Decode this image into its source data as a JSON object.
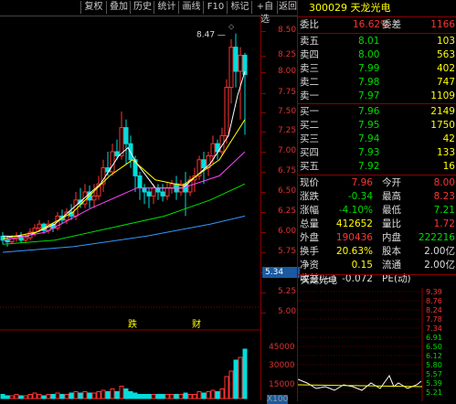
{
  "toolbar": {
    "buttons": [
      "复权",
      "叠加",
      "历史",
      "统计",
      "画线",
      "F10",
      "标记",
      "+自选",
      "返回"
    ]
  },
  "chart": {
    "max_label": "8.47",
    "annotations": [
      "跌",
      "财"
    ],
    "price_ticks": [
      "8.50",
      "8.25",
      "8.00",
      "7.75",
      "7.50",
      "7.25",
      "7.00",
      "6.75",
      "6.50",
      "6.25",
      "6.00",
      "5.75",
      "5.50",
      "5.25",
      "5.00"
    ],
    "current_price_tag": "5.34",
    "volume_ticks": [
      "45000",
      "30000",
      "15000"
    ],
    "vol_unit": "X100"
  },
  "quote": {
    "code": "300029",
    "name": "天龙光电",
    "weibi_label": "委比",
    "weibi_value": "16.62%",
    "weicha_label": "委差",
    "weicha_value": "1166",
    "asks": [
      {
        "label": "卖五",
        "price": "8.01",
        "vol": "103"
      },
      {
        "label": "卖四",
        "price": "8.00",
        "vol": "563"
      },
      {
        "label": "卖三",
        "price": "7.99",
        "vol": "402"
      },
      {
        "label": "卖二",
        "price": "7.98",
        "vol": "747"
      },
      {
        "label": "卖一",
        "price": "7.97",
        "vol": "1109"
      }
    ],
    "bids": [
      {
        "label": "买一",
        "price": "7.96",
        "vol": "2149"
      },
      {
        "label": "买二",
        "price": "7.95",
        "vol": "1750"
      },
      {
        "label": "买三",
        "price": "7.94",
        "vol": "42"
      },
      {
        "label": "买四",
        "price": "7.93",
        "vol": "133"
      },
      {
        "label": "买五",
        "price": "7.92",
        "vol": "16"
      }
    ],
    "stats": [
      {
        "l1": "现价",
        "v1": "7.96",
        "c1": "red",
        "l2": "今开",
        "v2": "8.00",
        "c2": "red"
      },
      {
        "l1": "涨跌",
        "v1": "-0.34",
        "c1": "green",
        "l2": "最高",
        "v2": "8.23",
        "c2": "red"
      },
      {
        "l1": "涨幅",
        "v1": "-4.10%",
        "c1": "green",
        "l2": "最低",
        "v2": "7.21",
        "c2": "green"
      },
      {
        "l1": "总量",
        "v1": "412652",
        "c1": "yellow",
        "l2": "量比",
        "v2": "1.72",
        "c2": "red"
      },
      {
        "l1": "外盘",
        "v1": "190436",
        "c1": "red",
        "l2": "内盘",
        "v2": "222216",
        "c2": "green"
      },
      {
        "l1": "换手",
        "v1": "20.63%",
        "c1": "yellow",
        "l2": "股本",
        "v2": "2.00亿",
        "c2": "white"
      },
      {
        "l1": "净资",
        "v1": "0.15",
        "c1": "yellow",
        "l2": "流通",
        "v2": "2.00亿",
        "c2": "white"
      },
      {
        "l1": "收益(三)",
        "v1": "-0.072",
        "c1": "white",
        "l2": "PE(动)",
        "v2": "",
        "c2": "white"
      }
    ]
  },
  "mini": {
    "title": "天龙光电",
    "ticks": [
      "9.39",
      "8.76",
      "8.24",
      "7.78",
      "7.34",
      "6.91",
      "6.50",
      "6.12",
      "5.80",
      "5.57",
      "5.39",
      "5.21"
    ]
  },
  "colors": {
    "up": "#ff3333",
    "down": "#00dd00",
    "ma5": "#ffffff",
    "ma10": "#ffff00",
    "ma20": "#ff44ff",
    "ma60": "#3399ff"
  }
}
